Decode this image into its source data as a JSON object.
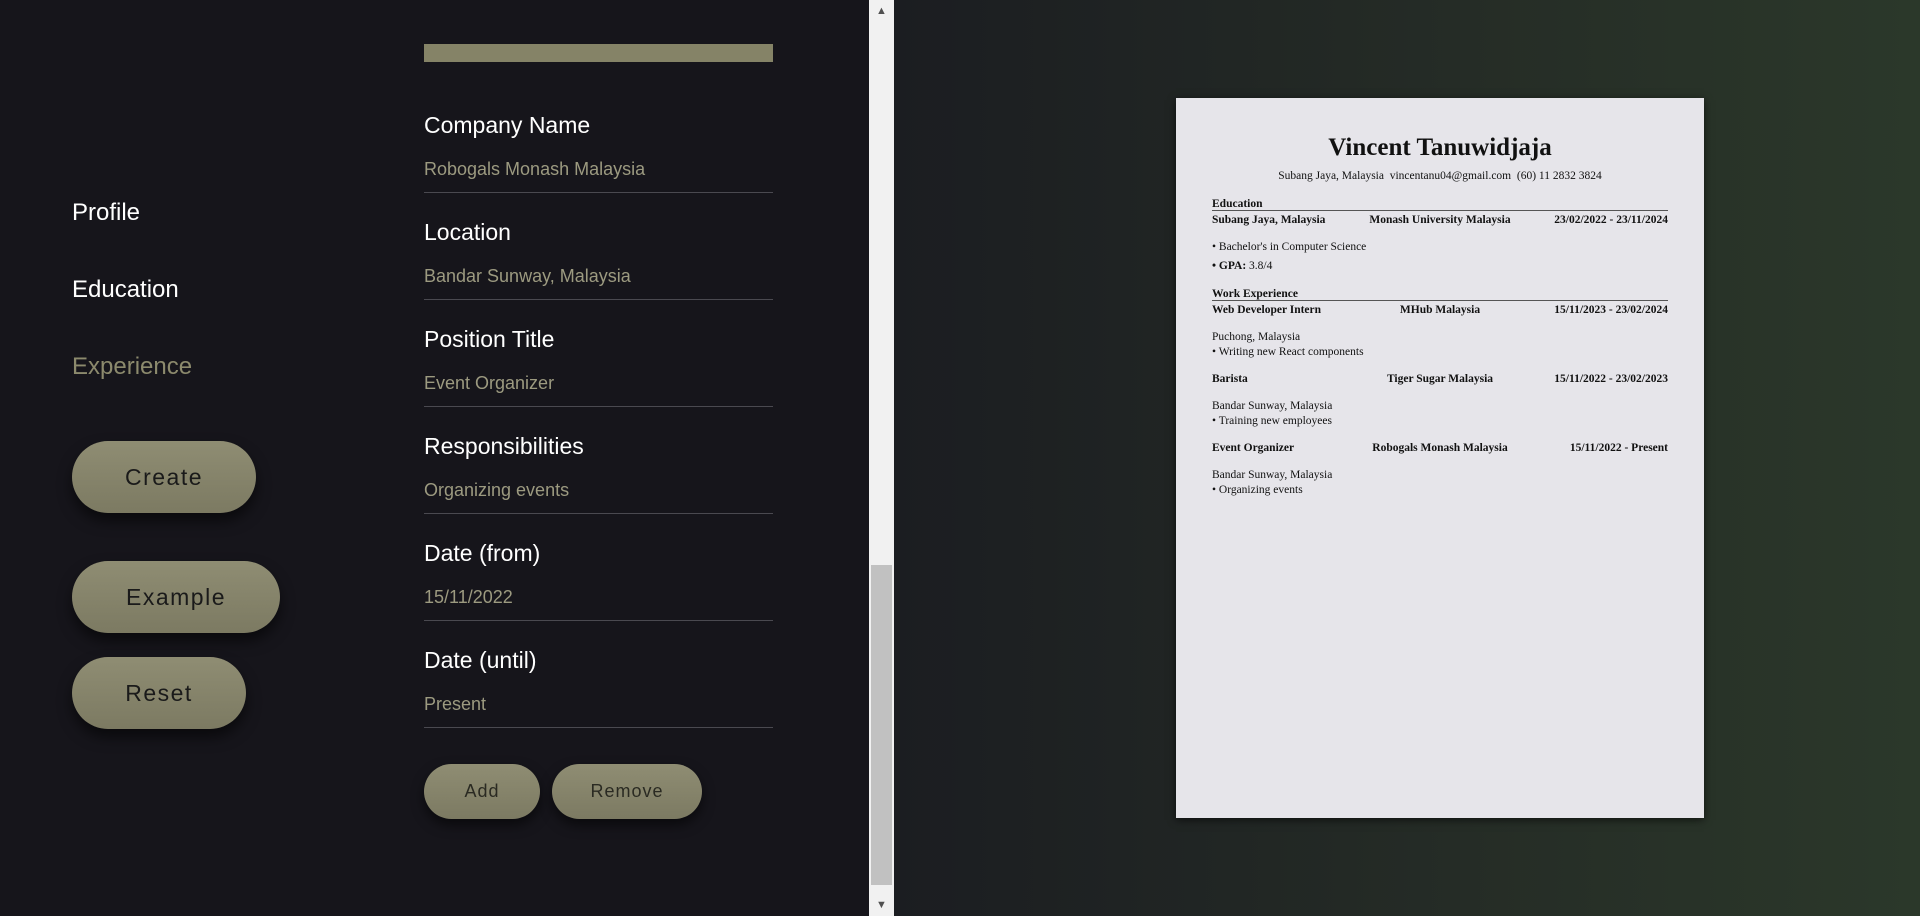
{
  "nav": {
    "profile": "Profile",
    "education": "Education",
    "experience": "Experience"
  },
  "actions": {
    "create": "Create",
    "example": "Example",
    "reset": "Reset"
  },
  "form": {
    "company_label": "Company Name",
    "company_value": "Robogals Monash Malaysia",
    "location_label": "Location",
    "location_value": "Bandar Sunway, Malaysia",
    "position_label": "Position Title",
    "position_value": "Event Organizer",
    "resp_label": "Responsibilities",
    "resp_value": "Organizing events",
    "from_label": "Date (from)",
    "from_value": "15/11/2022",
    "until_label": "Date (until)",
    "until_value": "Present",
    "add": "Add",
    "remove": "Remove"
  },
  "scrollbar": {
    "up_icon": "▲",
    "down_icon": "▼"
  },
  "resume": {
    "name": "Vincent Tanuwidjaja",
    "contact": "Subang Jaya, Malaysia  vincentanu04@gmail.com  (60) 11 2832 3824",
    "education_heading": "Education",
    "edu": {
      "location": "Subang Jaya, Malaysia",
      "school": "Monash University Malaysia",
      "dates": "23/02/2022 - 23/11/2024",
      "degree": "• Bachelor's in Computer Science",
      "gpa_label": "• GPA:",
      "gpa_value": " 3.8/4"
    },
    "work_heading": "Work Experience",
    "jobs": [
      {
        "title": "Web Developer Intern",
        "company": "MHub Malaysia",
        "dates": "15/11/2023 - 23/02/2024",
        "location": "Puchong, Malaysia",
        "duty": "• Writing new React components"
      },
      {
        "title": "Barista",
        "company": "Tiger Sugar Malaysia",
        "dates": "15/11/2022 - 23/02/2023",
        "location": "Bandar Sunway, Malaysia",
        "duty": "• Training new employees"
      },
      {
        "title": "Event Organizer",
        "company": "Robogals Monash Malaysia",
        "dates": "15/11/2022 - Present",
        "location": "Bandar Sunway, Malaysia",
        "duty": "• Organizing events"
      }
    ]
  },
  "colors": {
    "background": "#16151b",
    "accent": "#858367",
    "active_nav": "#8c8a6d",
    "field_value": "#9c9a80",
    "paper": "#e6e5ea"
  }
}
